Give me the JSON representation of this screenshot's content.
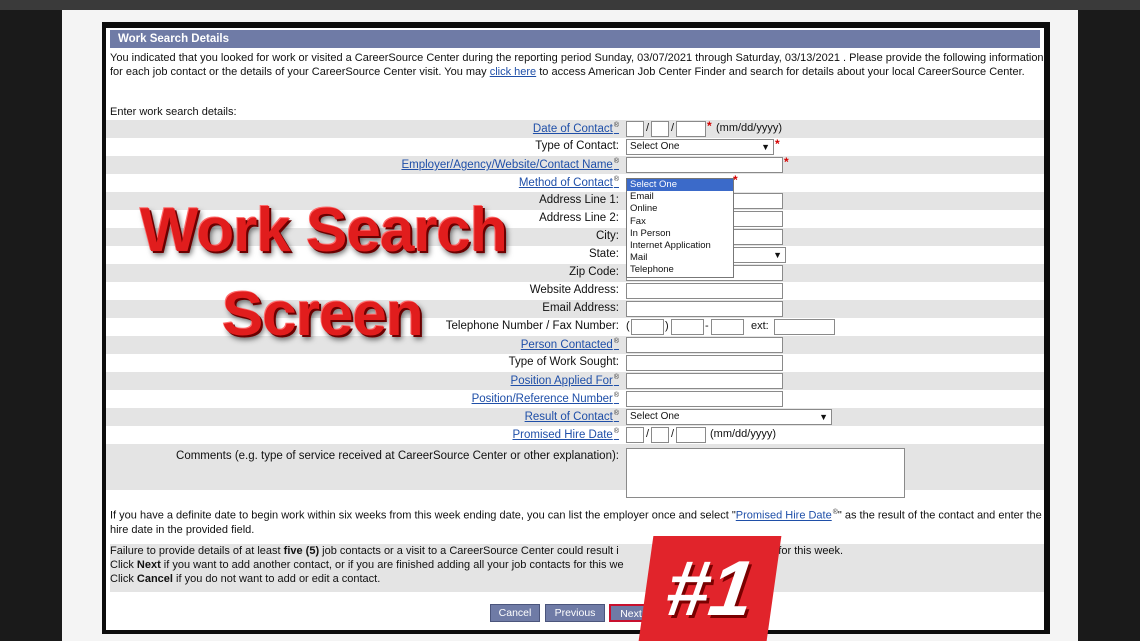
{
  "panel": {
    "title": "Work Search Details",
    "intro_before_link": "You indicated that you looked for work or visited a CareerSource Center during the reporting period Sunday, 03/07/2021 through Saturday, 03/13/2021 . Please provide the following information for each job contact or the details of your CareerSource Center visit. You may ",
    "intro_link": "click here",
    "intro_after_link": " to access American Job Center Finder and search for details about your local CareerSource Center.",
    "enter_label": "Enter work search details:"
  },
  "fields": {
    "date_of_contact": {
      "label": "Date of Contact",
      "hint": "(mm/dd/yyyy)"
    },
    "type_of_contact": {
      "label": "Type of Contact:",
      "value": "Select One"
    },
    "employer": {
      "label": "Employer/Agency/Website/Contact Name"
    },
    "method_of_contact": {
      "label": "Method of Contact"
    },
    "address1": {
      "label": "Address Line 1:"
    },
    "address2": {
      "label": "Address Line 2:"
    },
    "city": {
      "label": "City:"
    },
    "state": {
      "label": "State:"
    },
    "zip": {
      "label": "Zip Code:"
    },
    "website": {
      "label": "Website Address:"
    },
    "email": {
      "label": "Email Address:"
    },
    "phone": {
      "label": "Telephone Number / Fax Number:",
      "ext_label": "ext:"
    },
    "person_contacted": {
      "label": "Person Contacted"
    },
    "work_sought": {
      "label": "Type of Work Sought:"
    },
    "position_applied": {
      "label": "Position Applied For"
    },
    "position_ref": {
      "label": "Position/Reference Number"
    },
    "result_of_contact": {
      "label": "Result of Contact",
      "value": "Select One"
    },
    "promised_hire_date": {
      "label": "Promised Hire Date",
      "hint": "(mm/dd/yyyy)"
    },
    "comments": {
      "label": "Comments (e.g. type of service received at CareerSource Center or other explanation):"
    }
  },
  "method_dropdown": {
    "options": [
      "Select One",
      "Email",
      "Online",
      "Fax",
      "In Person",
      "Internet Application",
      "Mail",
      "Telephone"
    ],
    "selected_index": 0
  },
  "notes": {
    "promised_before": "If you have a definite date to begin work within six weeks from this week ending date, you can list the employer once and select \"",
    "promised_link": "Promised Hire Date",
    "promised_after": "\" as the result of the contact and enter the hire date in the provided field.",
    "failure_line_a": "Failure to provide details of at least ",
    "failure_bold": "five (5)",
    "failure_line_b": " job contacts or a visit to a CareerSource Center could result i",
    "failure_line_c": "benefits for this week.",
    "next_line_a": "Click ",
    "next_bold": "Next",
    "next_line_b": " if you want to add another contact, or if you are finished adding all your job contacts for this we",
    "cancel_line_a": "Click ",
    "cancel_bold": "Cancel",
    "cancel_line_b": " if you do not want to add or edit a contact."
  },
  "buttons": {
    "cancel": "Cancel",
    "previous": "Previous",
    "next": "Next"
  },
  "overlay": {
    "line1": "Work Search",
    "line2": "Screen",
    "badge": "#1"
  },
  "colors": {
    "header": "#6f7ba6",
    "link": "#1f4fa8",
    "required": "#d40000",
    "overlay_red": "#e11d1d"
  }
}
